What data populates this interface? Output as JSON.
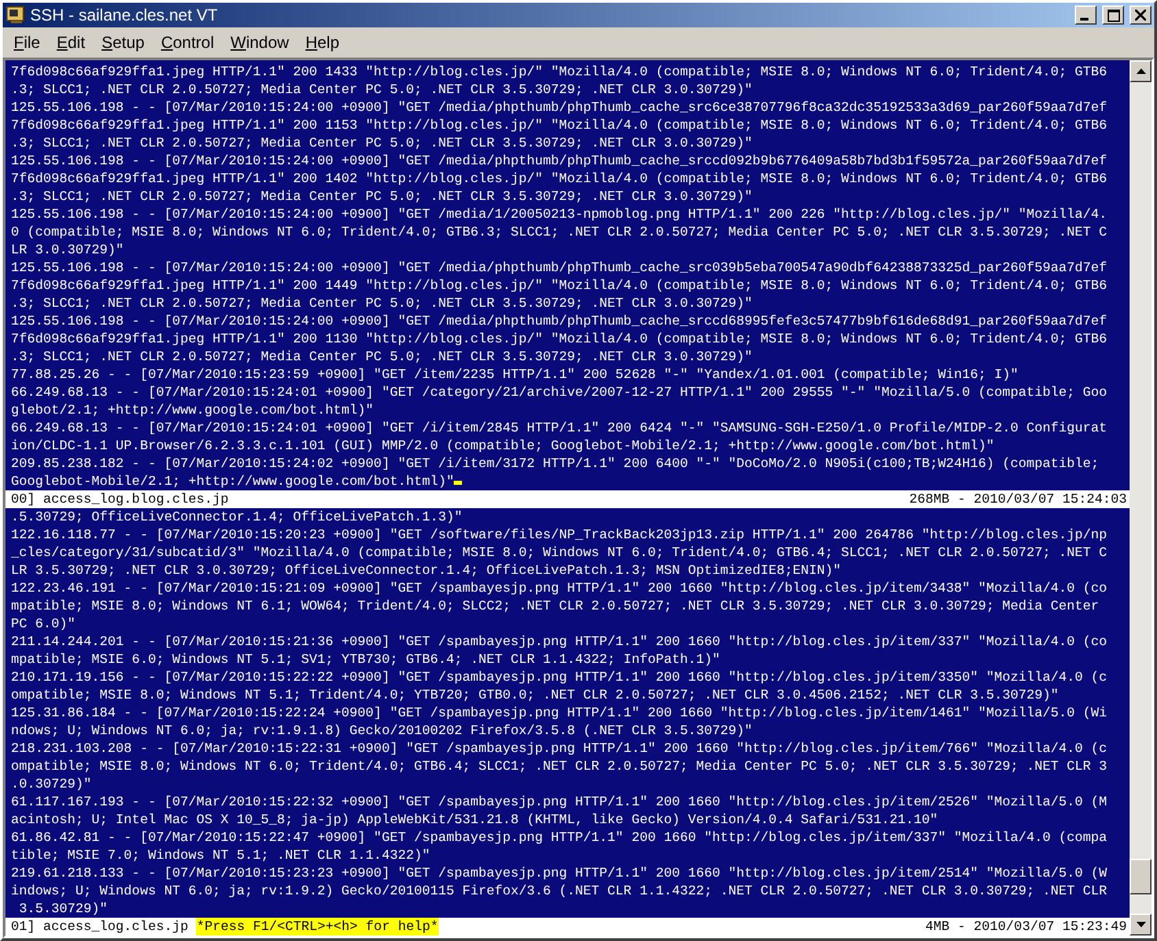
{
  "window": {
    "title": "SSH - sailane.cles.net VT"
  },
  "menu": [
    {
      "label": "File"
    },
    {
      "label": "Edit"
    },
    {
      "label": "Setup"
    },
    {
      "label": "Control"
    },
    {
      "label": "Window"
    },
    {
      "label": "Help"
    }
  ],
  "panes": [
    {
      "cursor": true,
      "lines": [
        "7f6d098c66af929ffa1.jpeg HTTP/1.1\" 200 1433 \"http://blog.cles.jp/\" \"Mozilla/4.0 (compatible; MSIE 8.0; Windows NT 6.0; Trident/4.0; GTB6",
        ".3; SLCC1; .NET CLR 2.0.50727; Media Center PC 5.0; .NET CLR 3.5.30729; .NET CLR 3.0.30729)\"",
        "125.55.106.198 - - [07/Mar/2010:15:24:00 +0900] \"GET /media/phpthumb/phpThumb_cache_src6ce38707796f8ca32dc35192533a3d69_par260f59aa7d7ef",
        "7f6d098c66af929ffa1.jpeg HTTP/1.1\" 200 1153 \"http://blog.cles.jp/\" \"Mozilla/4.0 (compatible; MSIE 8.0; Windows NT 6.0; Trident/4.0; GTB6",
        ".3; SLCC1; .NET CLR 2.0.50727; Media Center PC 5.0; .NET CLR 3.5.30729; .NET CLR 3.0.30729)\"",
        "125.55.106.198 - - [07/Mar/2010:15:24:00 +0900] \"GET /media/phpthumb/phpThumb_cache_srccd092b9b6776409a58b7bd3b1f59572a_par260f59aa7d7ef",
        "7f6d098c66af929ffa1.jpeg HTTP/1.1\" 200 1402 \"http://blog.cles.jp/\" \"Mozilla/4.0 (compatible; MSIE 8.0; Windows NT 6.0; Trident/4.0; GTB6",
        ".3; SLCC1; .NET CLR 2.0.50727; Media Center PC 5.0; .NET CLR 3.5.30729; .NET CLR 3.0.30729)\"",
        "125.55.106.198 - - [07/Mar/2010:15:24:00 +0900] \"GET /media/1/20050213-npmoblog.png HTTP/1.1\" 200 226 \"http://blog.cles.jp/\" \"Mozilla/4.",
        "0 (compatible; MSIE 8.0; Windows NT 6.0; Trident/4.0; GTB6.3; SLCC1; .NET CLR 2.0.50727; Media Center PC 5.0; .NET CLR 3.5.30729; .NET C",
        "LR 3.0.30729)\"",
        "125.55.106.198 - - [07/Mar/2010:15:24:00 +0900] \"GET /media/phpthumb/phpThumb_cache_src039b5eba700547a90dbf64238873325d_par260f59aa7d7ef",
        "7f6d098c66af929ffa1.jpeg HTTP/1.1\" 200 1449 \"http://blog.cles.jp/\" \"Mozilla/4.0 (compatible; MSIE 8.0; Windows NT 6.0; Trident/4.0; GTB6",
        ".3; SLCC1; .NET CLR 2.0.50727; Media Center PC 5.0; .NET CLR 3.5.30729; .NET CLR 3.0.30729)\"",
        "125.55.106.198 - - [07/Mar/2010:15:24:00 +0900] \"GET /media/phpthumb/phpThumb_cache_srccd68995fefe3c57477b9bf616de68d91_par260f59aa7d7ef",
        "7f6d098c66af929ffa1.jpeg HTTP/1.1\" 200 1130 \"http://blog.cles.jp/\" \"Mozilla/4.0 (compatible; MSIE 8.0; Windows NT 6.0; Trident/4.0; GTB6",
        ".3; SLCC1; .NET CLR 2.0.50727; Media Center PC 5.0; .NET CLR 3.5.30729; .NET CLR 3.0.30729)\"",
        "77.88.25.26 - - [07/Mar/2010:15:23:59 +0900] \"GET /item/2235 HTTP/1.1\" 200 52628 \"-\" \"Yandex/1.01.001 (compatible; Win16; I)\"",
        "66.249.68.13 - - [07/Mar/2010:15:24:01 +0900] \"GET /category/21/archive/2007-12-27 HTTP/1.1\" 200 29555 \"-\" \"Mozilla/5.0 (compatible; Goo",
        "glebot/2.1; +http://www.google.com/bot.html)\"",
        "66.249.68.13 - - [07/Mar/2010:15:24:01 +0900] \"GET /i/item/2845 HTTP/1.1\" 200 6424 \"-\" \"SAMSUNG-SGH-E250/1.0 Profile/MIDP-2.0 Configurat",
        "ion/CLDC-1.1 UP.Browser/6.2.3.3.c.1.101 (GUI) MMP/2.0 (compatible; Googlebot-Mobile/2.1; +http://www.google.com/bot.html)\"",
        "209.85.238.182 - - [07/Mar/2010:15:24:02 +0900] \"GET /i/item/3172 HTTP/1.1\" 200 6400 \"-\" \"DoCoMo/2.0 N905i(c100;TB;W24H16) (compatible;",
        "Googlebot-Mobile/2.1; +http://www.google.com/bot.html)\""
      ],
      "status": {
        "file": "00] access_log.blog.cles.jp",
        "info": "268MB - 2010/03/07 15:24:03"
      }
    },
    {
      "cursor": false,
      "lines": [
        ".5.30729; OfficeLiveConnector.1.4; OfficeLivePatch.1.3)\"",
        "122.16.118.77 - - [07/Mar/2010:15:20:23 +0900] \"GET /software/files/NP_TrackBack203jp13.zip HTTP/1.1\" 200 264786 \"http://blog.cles.jp/np",
        "_cles/category/31/subcatid/3\" \"Mozilla/4.0 (compatible; MSIE 8.0; Windows NT 6.0; Trident/4.0; GTB6.4; SLCC1; .NET CLR 2.0.50727; .NET C",
        "LR 3.5.30729; .NET CLR 3.0.30729; OfficeLiveConnector.1.4; OfficeLivePatch.1.3; MSN OptimizedIE8;ENIN)\"",
        "122.23.46.191 - - [07/Mar/2010:15:21:09 +0900] \"GET /spambayesjp.png HTTP/1.1\" 200 1660 \"http://blog.cles.jp/item/3438\" \"Mozilla/4.0 (co",
        "mpatible; MSIE 8.0; Windows NT 6.1; WOW64; Trident/4.0; SLCC2; .NET CLR 2.0.50727; .NET CLR 3.5.30729; .NET CLR 3.0.30729; Media Center",
        "PC 6.0)\"",
        "211.14.244.201 - - [07/Mar/2010:15:21:36 +0900] \"GET /spambayesjp.png HTTP/1.1\" 200 1660 \"http://blog.cles.jp/item/337\" \"Mozilla/4.0 (co",
        "mpatible; MSIE 6.0; Windows NT 5.1; SV1; YTB730; GTB6.4; .NET CLR 1.1.4322; InfoPath.1)\"",
        "210.171.19.156 - - [07/Mar/2010:15:22:22 +0900] \"GET /spambayesjp.png HTTP/1.1\" 200 1660 \"http://blog.cles.jp/item/3350\" \"Mozilla/4.0 (c",
        "ompatible; MSIE 8.0; Windows NT 5.1; Trident/4.0; YTB720; GTB0.0; .NET CLR 2.0.50727; .NET CLR 3.0.4506.2152; .NET CLR 3.5.30729)\"",
        "125.31.86.184 - - [07/Mar/2010:15:22:24 +0900] \"GET /spambayesjp.png HTTP/1.1\" 200 1660 \"http://blog.cles.jp/item/1461\" \"Mozilla/5.0 (Wi",
        "ndows; U; Windows NT 6.0; ja; rv:1.9.1.8) Gecko/20100202 Firefox/3.5.8 (.NET CLR 3.5.30729)\"",
        "218.231.103.208 - - [07/Mar/2010:15:22:31 +0900] \"GET /spambayesjp.png HTTP/1.1\" 200 1660 \"http://blog.cles.jp/item/766\" \"Mozilla/4.0 (c",
        "ompatible; MSIE 8.0; Windows NT 6.0; Trident/4.0; GTB6.4; SLCC1; .NET CLR 2.0.50727; Media Center PC 5.0; .NET CLR 3.5.30729; .NET CLR 3",
        ".0.30729)\"",
        "61.117.167.193 - - [07/Mar/2010:15:22:32 +0900] \"GET /spambayesjp.png HTTP/1.1\" 200 1660 \"http://blog.cles.jp/item/2526\" \"Mozilla/5.0 (M",
        "acintosh; U; Intel Mac OS X 10_5_8; ja-jp) AppleWebKit/531.21.8 (KHTML, like Gecko) Version/4.0.4 Safari/531.21.10\"",
        "61.86.42.81 - - [07/Mar/2010:15:22:47 +0900] \"GET /spambayesjp.png HTTP/1.1\" 200 1660 \"http://blog.cles.jp/item/337\" \"Mozilla/4.0 (compa",
        "tible; MSIE 7.0; Windows NT 5.1; .NET CLR 1.1.4322)\"",
        "219.61.218.133 - - [07/Mar/2010:15:23:23 +0900] \"GET /spambayesjp.png HTTP/1.1\" 200 1660 \"http://blog.cles.jp/item/2514\" \"Mozilla/5.0 (W",
        "indows; U; Windows NT 6.0; ja; rv:1.9.2) Gecko/20100115 Firefox/3.6 (.NET CLR 1.1.4322; .NET CLR 2.0.50727; .NET CLR 3.0.30729; .NET CLR",
        " 3.5.30729)\""
      ],
      "status": {
        "file": "01] access_log.cles.jp",
        "help": "*Press F1/<CTRL>+<h> for help*",
        "info": "4MB - 2010/03/07 15:23:49"
      }
    }
  ]
}
